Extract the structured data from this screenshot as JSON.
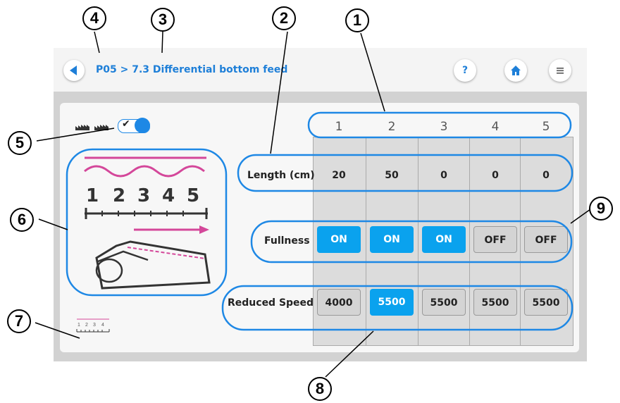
{
  "header": {
    "breadcrumb": "P05 > 7.3 Differential bottom feed",
    "help_label": "?",
    "back_icon": "chevron-left-icon",
    "home_icon": "home-icon",
    "menu_icon": "menu-icon"
  },
  "toggle": {
    "state": "on",
    "check": "✔"
  },
  "illustration": {
    "numbers": [
      "1",
      "2",
      "3",
      "4",
      "5"
    ]
  },
  "table": {
    "columns": [
      "1",
      "2",
      "3",
      "4",
      "5"
    ],
    "length": {
      "label": "Length (cm)",
      "values": [
        "20",
        "50",
        "0",
        "0",
        "0"
      ]
    },
    "fullness": {
      "label": "Fullness",
      "values": [
        "ON",
        "ON",
        "ON",
        "OFF",
        "OFF"
      ]
    },
    "reduced_speed": {
      "label": "Reduced Speed",
      "values": [
        "4000",
        "5500",
        "5500",
        "5500",
        "5500"
      ],
      "selected_index": 1
    }
  },
  "callouts": [
    "1",
    "2",
    "3",
    "4",
    "5",
    "6",
    "7",
    "8",
    "9"
  ],
  "colors": {
    "accent": "#0aa2ee",
    "highlight": "#1e88e5",
    "link": "#1e7fd8",
    "pink": "#d4479a"
  }
}
